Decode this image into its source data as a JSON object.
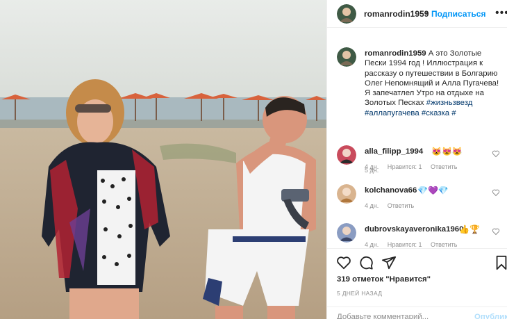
{
  "header": {
    "username": "romanrodin1959",
    "separator": "•",
    "follow_label": "Подписаться",
    "more_glyph": "•••"
  },
  "caption": {
    "username": "romanrodin1959",
    "text": " А это Золотые Пески 1994 год ! Иллюстрация к рассказу о путешествии в Болгарию Олег Непомнящий и Алла Пугачева! Я запечатлел Утро на отдыхе на Золотых Песках ",
    "tags": [
      "#жизньзвезд",
      "#аллапугачева",
      "#сказка",
      "#"
    ],
    "time": "5 дн."
  },
  "comments": [
    {
      "username": "alla_filipp_1994",
      "text": "😻😻😻",
      "time": "4 дн.",
      "likes": "Нравится: 1",
      "reply": "Ответить",
      "avatar_color": "#c94b5c"
    },
    {
      "username": "kolchanova66",
      "text": "💎💜💎",
      "time": "4 дн.",
      "likes": "",
      "reply": "Ответить",
      "avatar_color": "#d9b48f"
    },
    {
      "username": "dubrovskayaveronika1960",
      "text": "👍🏆",
      "time": "4 дн.",
      "likes": "Нравится: 1",
      "reply": "Ответить",
      "avatar_color": "#8a9cc2"
    }
  ],
  "actions": {
    "icons": [
      "heart-icon",
      "comment-icon",
      "share-icon",
      "bookmark-icon"
    ],
    "likes_text": "319 отметок \"Нравится\"",
    "date": "5 ДНЕЙ НАЗАД"
  },
  "add_comment": {
    "placeholder": "Добавьте комментарий...",
    "publish_label": "Опубликовать"
  },
  "colors": {
    "accent": "#0095f6",
    "hashtag": "#00376b",
    "muted": "#8e8e8e"
  }
}
